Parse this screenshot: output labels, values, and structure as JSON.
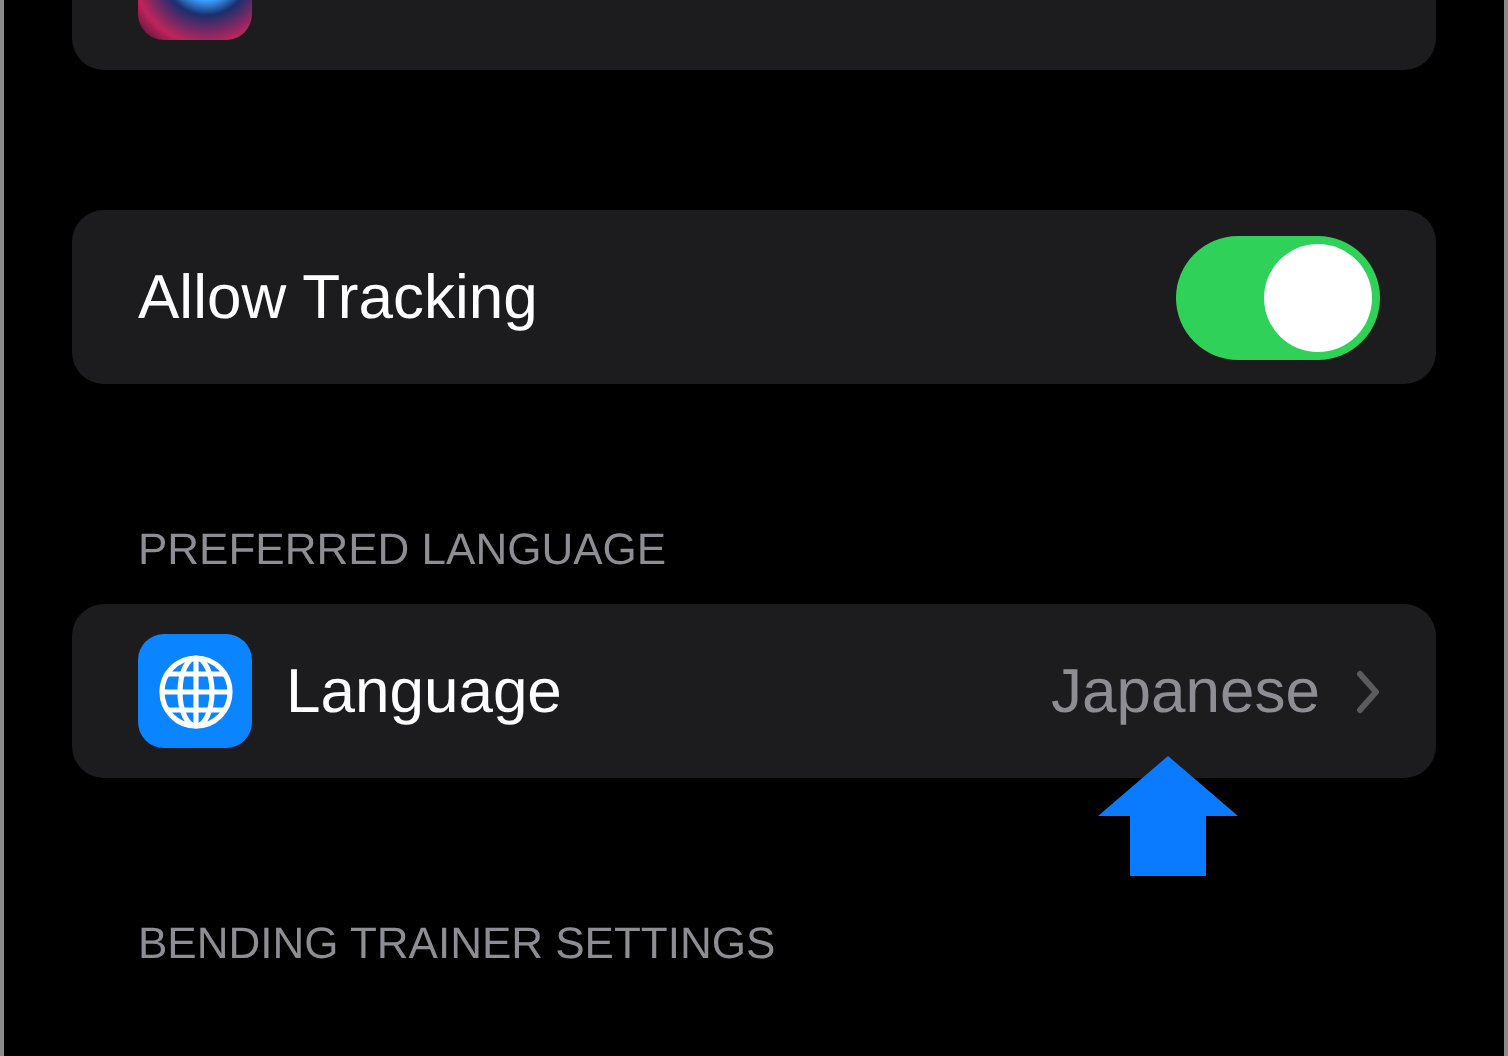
{
  "groups": [
    {
      "kind": "cut"
    },
    {
      "kind": "toggle",
      "label": "Allow Tracking",
      "on": true
    },
    {
      "kind": "link",
      "header": "PREFERRED LANGUAGE",
      "label": "Language",
      "value": "Japanese"
    },
    {
      "kind": "header",
      "header": "BENDING TRAINER SETTINGS"
    }
  ]
}
